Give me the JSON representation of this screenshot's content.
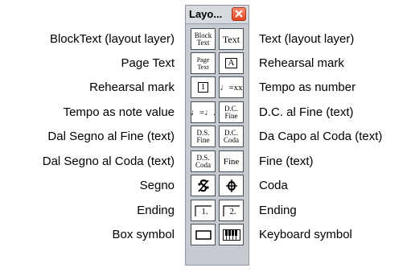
{
  "window": {
    "title": "Layo...",
    "close_icon": "close-icon"
  },
  "tools": [
    {
      "label_left": "BlockText (layout layer)",
      "icon_left": "Block\nText",
      "label_right": "Text (layout layer)",
      "icon_right": "Text"
    },
    {
      "label_left": "Page Text",
      "icon_left": "Page\nText",
      "label_right": "Rehearsal mark",
      "icon_right": "A"
    },
    {
      "label_left": "Rehearsal mark",
      "icon_left": "1",
      "label_right": "Tempo as number",
      "icon_right": "♩=xx"
    },
    {
      "label_left": "Tempo as note value",
      "icon_left": "♩=♩.",
      "label_right": "D.C. al Fine (text)",
      "icon_right": "D.C.\nFine"
    },
    {
      "label_left": "Dal Segno al Fine (text)",
      "icon_left": "D.S.\nFine",
      "label_right": "Da Capo al Coda (text)",
      "icon_right": "D.C.\nCoda"
    },
    {
      "label_left": "Dal Segno al Coda (text)",
      "icon_left": "D.S.\nCoda",
      "label_right": "Fine (text)",
      "icon_right": "Fine"
    },
    {
      "label_left": "Segno",
      "icon_left": "segno-icon",
      "label_right": "Coda",
      "icon_right": "coda-icon"
    },
    {
      "label_left": "Ending",
      "icon_left": "1.",
      "label_right": "Ending",
      "icon_right": "2."
    },
    {
      "label_left": "Box symbol",
      "icon_left": "box-icon",
      "label_right": "Keyboard symbol",
      "icon_right": "keyboard-icon"
    }
  ]
}
